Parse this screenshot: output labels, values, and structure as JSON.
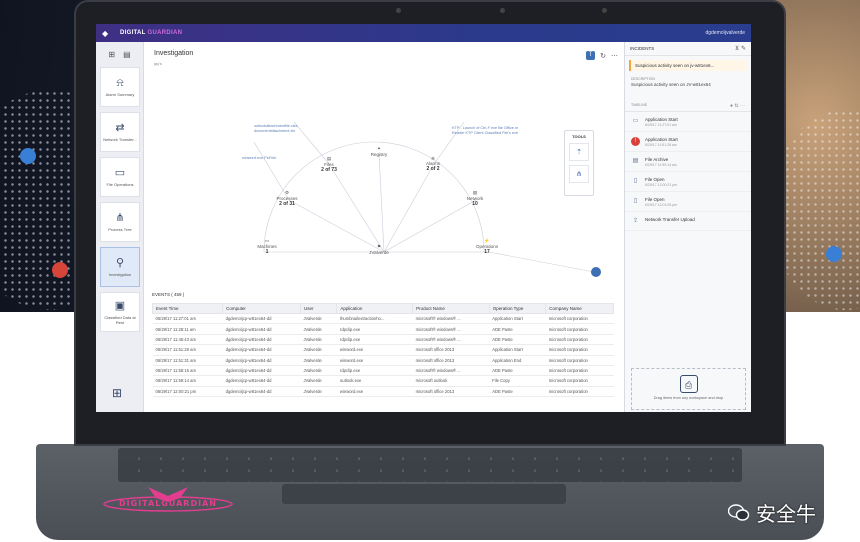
{
  "watermark": {
    "text": "安全牛"
  },
  "laptop": {
    "brand_logo": "DIGITALGUARDIAN"
  },
  "topbar": {
    "brand_part1": "DIGITAL",
    "brand_part2": "GUARDIAN",
    "user": "dgdemo\\jvalverde"
  },
  "sidebar": {
    "items": [
      {
        "label": "Alarm Summary",
        "icon": "alarm-bell-icon"
      },
      {
        "label": "Network Transfer...",
        "icon": "network-transfer-icon"
      },
      {
        "label": "File Operations",
        "icon": "file-icon"
      },
      {
        "label": "Process Tree",
        "icon": "process-tree-icon"
      },
      {
        "label": "Investigation",
        "icon": "investigation-icon"
      },
      {
        "label": "Classified Data at Rest",
        "icon": "classified-data-icon"
      }
    ]
  },
  "main": {
    "title": "Investigation",
    "subtitle": "jay's"
  },
  "graph": {
    "center": {
      "label": "JValverde"
    },
    "nodes": [
      {
        "name": "Machines",
        "value": "1",
        "icon": "monitor-icon"
      },
      {
        "name": "Processes",
        "value": "2 of 31",
        "icon": "gear-icon"
      },
      {
        "name": "Files",
        "value": "2 of 73",
        "icon": "file-icon"
      },
      {
        "name": "Registry",
        "value": "",
        "icon": "registry-icon"
      },
      {
        "name": "Alarms",
        "value": "2 of 2",
        "icon": "alarm-icon"
      },
      {
        "name": "Network",
        "value": "10",
        "icon": "network-icon"
      },
      {
        "name": "Operations",
        "value": "17",
        "icon": "operations-icon"
      }
    ],
    "annotations": [
      "outlookattachmentfile.xlsx documentattachment.xls",
      "winword.exe Pid/Ver",
      "KTP - Launch of Ctrl-F exe tile Office.m Reader KTP Client Classified File's exe"
    ],
    "tools_title": "TOOLS"
  },
  "events": {
    "title": "EVENTS ( 459 )",
    "columns": [
      "Event Time",
      "Computer",
      "User",
      "Application",
      "Product Name",
      "Operation Type",
      "Company Name"
    ],
    "rows": [
      [
        "06/29/17 11:27:01 am",
        "dgdemo\\jcp-w81ex64-dd",
        "JValverde",
        "thumbnailextractionho...",
        "microsoft® windows® ...",
        "Application Start",
        "microsoft corporation"
      ],
      [
        "06/29/17 11:28:11 am",
        "dgdemo\\jcp-w81ex64-dd",
        "JValverde",
        "rdpclip.exe",
        "microsoft® windows® ...",
        "ADE Paste",
        "microsoft corporation"
      ],
      [
        "06/29/17 11:45:43 am",
        "dgdemo\\jcp-w81ex64-dd",
        "JValverde",
        "rdpclip.exe",
        "microsoft® windows® ...",
        "ADE Paste",
        "microsoft corporation"
      ],
      [
        "06/29/17 11:51:28 am",
        "dgdemo\\jcp-w81ex64-dd",
        "JValverde",
        "winword.exe",
        "microsoft office 2013",
        "Application Start",
        "microsoft corporation"
      ],
      [
        "06/29/17 11:51:31 am",
        "dgdemo\\jcp-w81ex64-dd",
        "JValverde",
        "winword.exe",
        "microsoft office 2013",
        "Application End",
        "microsoft corporation"
      ],
      [
        "06/29/17 11:58:15 am",
        "dgdemo\\jcp-w81ex64-dd",
        "JValverde",
        "rdpclip.exe",
        "microsoft® windows® ...",
        "ADE Paste",
        "microsoft corporation"
      ],
      [
        "06/29/17 11:59:14 am",
        "dgdemo\\jcp-w81ex64-dd",
        "JValverde",
        "outlook.exe",
        "microsoft outlook",
        "File Copy",
        "microsoft corporation"
      ],
      [
        "06/29/17 12:00:21 pm",
        "dgdemo\\jcp-w81ex64-dd",
        "JValverde",
        "winword.exe",
        "microsoft office 2013",
        "ADE Paste",
        "microsoft corporation"
      ]
    ]
  },
  "incidents": {
    "title": "INCIDENTS",
    "alert": "Suspicious activity seen on jv-w81ex6...",
    "description_label": "DESCRIPTION",
    "description": "Suspicious activity seen on JV-w81ex64",
    "timeline_label": "TIMELINE",
    "timeline": [
      {
        "title": "Application Start",
        "time": "6/29/17 11:27:01 am",
        "icon": "application-icon",
        "alert": false
      },
      {
        "title": "Application Start",
        "time": "6/29/17 11:51:28 am",
        "icon": "application-icon",
        "alert": true
      },
      {
        "title": "File Archive",
        "time": "6/29/17 11:59:14 am",
        "icon": "archive-icon",
        "alert": false
      },
      {
        "title": "File Open",
        "time": "6/29/17 12:00:21 pm",
        "icon": "file-icon",
        "alert": false
      },
      {
        "title": "File Open",
        "time": "6/29/17 12:01:05 pm",
        "icon": "file-icon",
        "alert": false
      },
      {
        "title": "Network Transfer Upload",
        "time": "",
        "icon": "upload-icon",
        "alert": false
      }
    ],
    "dropzone": "Drag items from any workspace and drop"
  }
}
